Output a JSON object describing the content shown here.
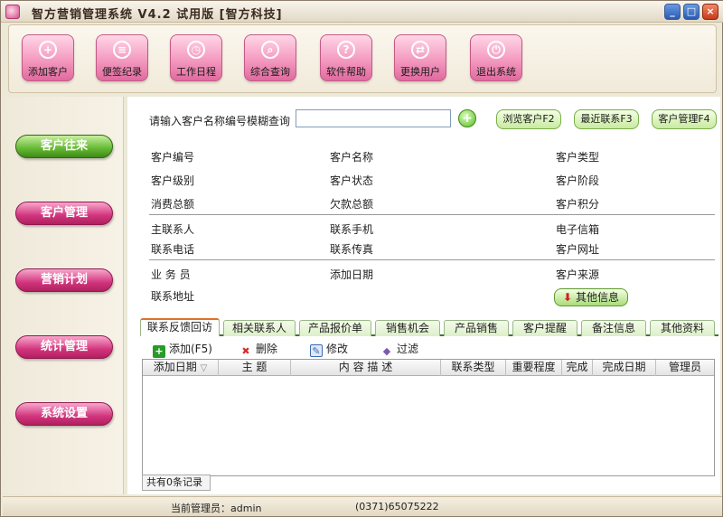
{
  "window": {
    "title": "智方营销管理系统 V4.2 试用版 [智方科技]",
    "minimize": "_",
    "maximize": "□",
    "close": "×"
  },
  "toolbar": [
    {
      "label": "添加客户",
      "icon": "user-add-icon",
      "glyph": "+"
    },
    {
      "label": "便签纪录",
      "icon": "note-icon",
      "glyph": "≡"
    },
    {
      "label": "工作日程",
      "icon": "calendar-icon",
      "glyph": "◷"
    },
    {
      "label": "综合查询",
      "icon": "search-icon",
      "glyph": "⌕"
    },
    {
      "label": "软件帮助",
      "icon": "help-icon",
      "glyph": "?"
    },
    {
      "label": "更换用户",
      "icon": "switch-user-icon",
      "glyph": "⇄"
    },
    {
      "label": "退出系统",
      "icon": "exit-icon",
      "glyph": "⏻"
    }
  ],
  "sidebar": [
    {
      "label": "客户往来",
      "active": true
    },
    {
      "label": "客户管理",
      "active": false
    },
    {
      "label": "营销计划",
      "active": false
    },
    {
      "label": "统计管理",
      "active": false
    },
    {
      "label": "系统设置",
      "active": false
    }
  ],
  "search": {
    "label": "请输入客户名称编号模糊查询",
    "value": "",
    "go": "+"
  },
  "quick_buttons": [
    "浏览客户F2",
    "最近联系F3",
    "客户管理F4"
  ],
  "fields": {
    "row1": [
      "客户编号",
      "客户名称",
      "客户类型"
    ],
    "row2": [
      "客户级别",
      "客户状态",
      "客户阶段"
    ],
    "row3": [
      "消费总额",
      "欠款总额",
      "客户积分"
    ],
    "row4": [
      "主联系人",
      "联系手机",
      "电子信箱"
    ],
    "row5": [
      "联系电话",
      "联系传真",
      "客户网址"
    ],
    "row6": [
      "业 务 员",
      "添加日期",
      "客户来源"
    ],
    "row7": [
      "联系地址"
    ]
  },
  "other_info": "其他信息",
  "tabs": [
    "联系反馈回访",
    "相关联系人",
    "产品报价单",
    "销售机会",
    "产品销售",
    "客户提醒",
    "备注信息",
    "其他资料"
  ],
  "actions": [
    {
      "label": "添加(F5)",
      "icon": "add-icon",
      "color": "#2a9a2a"
    },
    {
      "label": "删除",
      "icon": "delete-icon",
      "color": "#d03030"
    },
    {
      "label": "修改",
      "icon": "edit-icon",
      "color": "#3a6ab0"
    },
    {
      "label": "过滤",
      "icon": "filter-icon",
      "color": "#7a5ab0"
    }
  ],
  "grid": {
    "columns": [
      "添加日期",
      "主 题",
      "内 容 描 述",
      "联系类型",
      "重要程度",
      "完成",
      "完成日期",
      "管理员"
    ],
    "sort_indicator": "▽",
    "count_text": "共有0条记录"
  },
  "status": {
    "admin_label": "当前管理员：admin",
    "phone": "(0371)65075222"
  },
  "colors": {
    "accent_pink": "#d2357e",
    "accent_green": "#64b832"
  }
}
